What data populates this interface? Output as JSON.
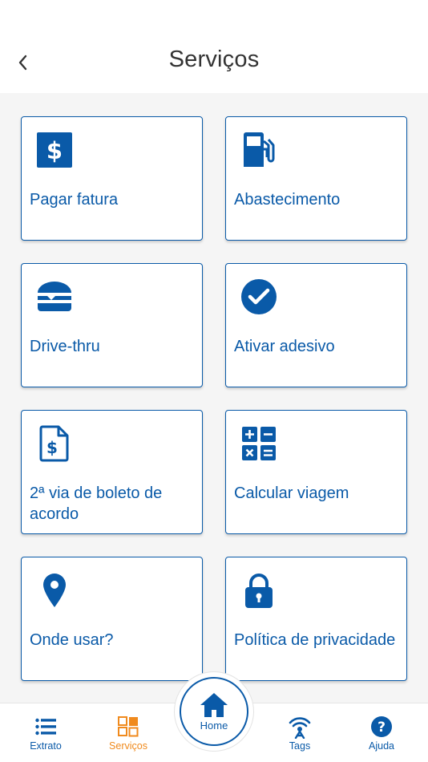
{
  "header": {
    "title": "Serviços",
    "back_icon": "chevron-left-icon"
  },
  "services": [
    {
      "label": "Pagar fatura",
      "icon": "dollar-square-icon"
    },
    {
      "label": "Abastecimento",
      "icon": "fuel-pump-icon"
    },
    {
      "label": "Drive-thru",
      "icon": "burger-icon"
    },
    {
      "label": "Ativar adesivo",
      "icon": "check-circle-icon"
    },
    {
      "label": "2ª via de boleto de acordo",
      "icon": "dollar-document-icon"
    },
    {
      "label": "Calcular viagem",
      "icon": "calculator-icon"
    },
    {
      "label": "Onde usar?",
      "icon": "map-pin-icon"
    },
    {
      "label": "Política de privacidade",
      "icon": "lock-icon"
    }
  ],
  "bottom_nav": {
    "items": [
      {
        "label": "Extrato",
        "icon": "list-icon"
      },
      {
        "label": "Serviços",
        "icon": "grid-icon",
        "active": true
      },
      {
        "label": "Home",
        "icon": "home-icon"
      },
      {
        "label": "Tags",
        "icon": "tag-signal-icon"
      },
      {
        "label": "Ajuda",
        "icon": "help-circle-icon"
      }
    ]
  },
  "colors": {
    "primary": "#0a5aa8",
    "active": "#f08a1d",
    "background": "#f5f5f5"
  }
}
